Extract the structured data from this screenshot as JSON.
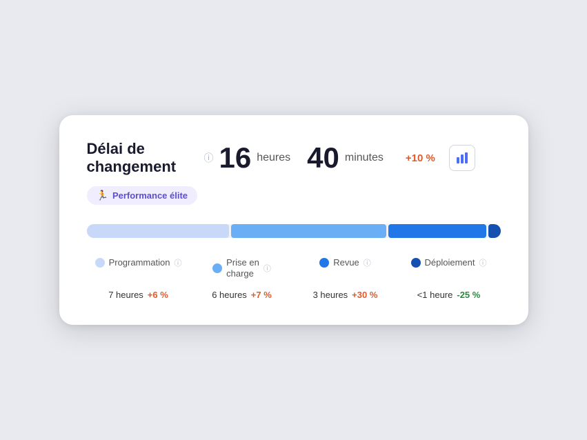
{
  "card": {
    "title_line1": "Délai de",
    "title_line2": "changement",
    "metric1_value": "16",
    "metric1_unit": "heures",
    "metric2_value": "40",
    "metric2_unit": "minutes",
    "change": "+10 %",
    "badge_label": "Performance élite",
    "badge_icon": "🏃‍♂️"
  },
  "bars": [
    {
      "color": "#c8d8f8",
      "width": 35
    },
    {
      "color": "#6aaef5",
      "width": 38
    },
    {
      "color": "#2176e8",
      "width": 25
    },
    {
      "color": "#1450b0",
      "width": 2
    }
  ],
  "legend": [
    {
      "label": "Programmation",
      "dot_color": "#c8d8f8",
      "value": "7 heures",
      "change": "+6 %",
      "positive": true
    },
    {
      "label": "Prise en charge",
      "dot_color": "#6aaef5",
      "value": "6 heures",
      "change": "+7 %",
      "positive": true
    },
    {
      "label": "Revue",
      "dot_color": "#2176e8",
      "value": "3 heures",
      "change": "+30 %",
      "positive": true
    },
    {
      "label": "Déploiement",
      "dot_color": "#1450b0",
      "value": "<1 heure",
      "change": "-25 %",
      "positive": false
    }
  ],
  "icons": {
    "info": "ⓘ",
    "chart": "📊"
  }
}
